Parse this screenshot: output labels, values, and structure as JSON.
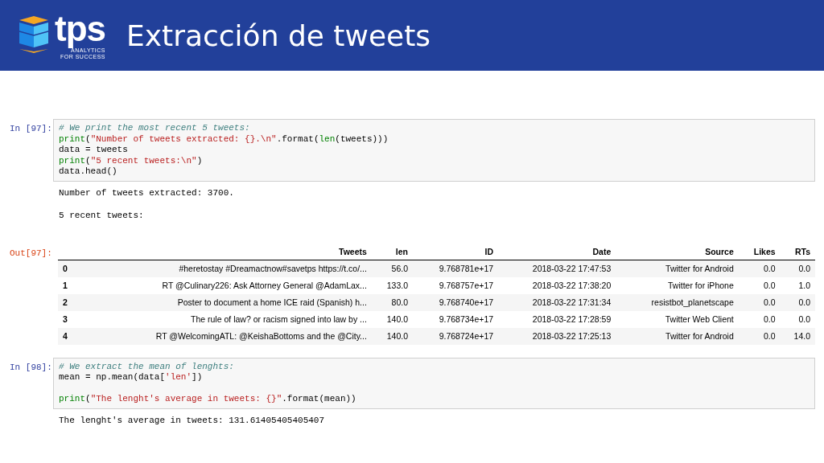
{
  "header": {
    "logo": {
      "wordmark": "tps",
      "tagline_1": "ANALYTICS",
      "tagline_2": "FOR SUCCESS"
    },
    "title": "Extracción de tweets"
  },
  "cells": [
    {
      "prompt": "In [97]:",
      "code": [
        {
          "space_before": false,
          "tokens": [
            {
              "t": "# We print the most recent 5 tweets:",
              "kind": "comment"
            }
          ]
        },
        {
          "space_before": false,
          "tokens": [
            {
              "t": "print",
              "kind": "builtin"
            },
            {
              "t": "(",
              "kind": "plain"
            },
            {
              "t": "\"Number of tweets extracted: {}.\\n\"",
              "kind": "string"
            },
            {
              "t": ".format(",
              "kind": "plain"
            },
            {
              "t": "len",
              "kind": "builtin"
            },
            {
              "t": "(tweets)))",
              "kind": "plain"
            }
          ]
        },
        {
          "space_before": false,
          "tokens": [
            {
              "t": "data = tweets",
              "kind": "plain"
            }
          ]
        },
        {
          "space_before": false,
          "tokens": [
            {
              "t": "print",
              "kind": "builtin"
            },
            {
              "t": "(",
              "kind": "plain"
            },
            {
              "t": "\"5 recent tweets:\\n\"",
              "kind": "string"
            },
            {
              "t": ")",
              "kind": "plain"
            }
          ]
        },
        {
          "space_before": false,
          "tokens": [
            {
              "t": "data.head()",
              "kind": "plain"
            }
          ]
        }
      ],
      "stdout": [
        "Number of tweets extracted: 3700.",
        "5 recent tweets:"
      ],
      "out_prompt": "Out[97]:",
      "table": {
        "columns": [
          "Tweets",
          "len",
          "ID",
          "Date",
          "Source",
          "Likes",
          "RTs"
        ],
        "rows": [
          {
            "index": "0",
            "cells": [
              "#heretostay #Dreamactnow#savetps https://t.co/...",
              "56.0",
              "9.768781e+17",
              "2018-03-22 17:47:53",
              "Twitter for Android",
              "0.0",
              "0.0"
            ]
          },
          {
            "index": "1",
            "cells": [
              "RT @Culinary226: Ask Attorney General @AdamLax...",
              "133.0",
              "9.768757e+17",
              "2018-03-22 17:38:20",
              "Twitter for iPhone",
              "0.0",
              "1.0"
            ]
          },
          {
            "index": "2",
            "cells": [
              "Poster to document a home ICE raid (Spanish) h...",
              "80.0",
              "9.768740e+17",
              "2018-03-22 17:31:34",
              "resistbot_planetscape",
              "0.0",
              "0.0"
            ]
          },
          {
            "index": "3",
            "cells": [
              "The rule of law? or racism signed into law by ...",
              "140.0",
              "9.768734e+17",
              "2018-03-22 17:28:59",
              "Twitter Web Client",
              "0.0",
              "0.0"
            ]
          },
          {
            "index": "4",
            "cells": [
              "RT @WelcomingATL: @KeishaBottoms and the @City...",
              "140.0",
              "9.768724e+17",
              "2018-03-22 17:25:13",
              "Twitter for Android",
              "0.0",
              "14.0"
            ]
          }
        ]
      }
    },
    {
      "prompt": "In [98]:",
      "code": [
        {
          "space_before": false,
          "tokens": [
            {
              "t": "# We extract the mean of lenghts:",
              "kind": "comment"
            }
          ]
        },
        {
          "space_before": false,
          "tokens": [
            {
              "t": "mean = np.mean(data[",
              "kind": "plain"
            },
            {
              "t": "'len'",
              "kind": "string"
            },
            {
              "t": "])",
              "kind": "plain"
            }
          ]
        },
        {
          "space_before": true,
          "tokens": [
            {
              "t": "print",
              "kind": "builtin"
            },
            {
              "t": "(",
              "kind": "plain"
            },
            {
              "t": "\"The lenght's average in tweets: {}\"",
              "kind": "string"
            },
            {
              "t": ".format(mean))",
              "kind": "plain"
            }
          ]
        }
      ],
      "stdout": [
        "The lenght's average in tweets: 131.61405405405407"
      ]
    }
  ]
}
